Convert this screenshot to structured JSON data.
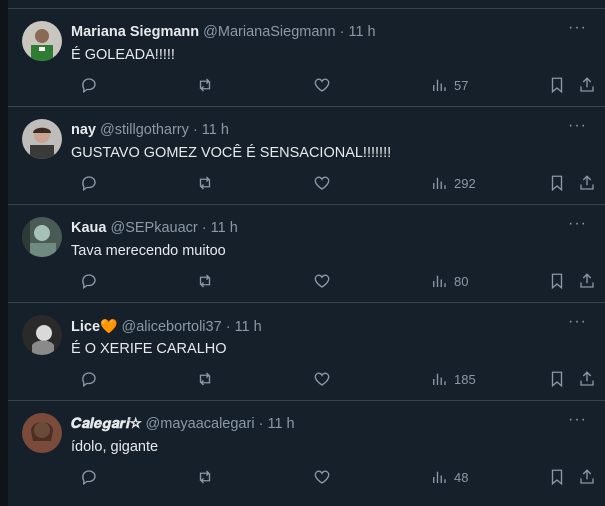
{
  "tweets": [
    {
      "name": "Mariana Siegmann",
      "handle": "@MarianaSiegmann",
      "time": "11 h",
      "text": "É GOLEADA!!!!!",
      "views": "57",
      "avatar_colors": [
        "#c9c6bf",
        "#2e7d32"
      ]
    },
    {
      "name": "nay",
      "handle": "@stillgotharry",
      "time": "11 h",
      "text": "GUSTAVO GOMEZ VOCÊ É SENSACIONAL!!!!!!!",
      "views": "292",
      "avatar_colors": [
        "#bfbcbc",
        "#3a3a3a"
      ]
    },
    {
      "name": "Kaua",
      "handle": "@SEPkauacr",
      "time": "11 h",
      "text": "Tava merecendo muitoo",
      "views": "80",
      "avatar_colors": [
        "#4a5b55",
        "#a7c1b8"
      ]
    },
    {
      "name": "Lice",
      "name_emoji": "🧡",
      "handle": "@alicebortoli37",
      "time": "11 h",
      "text": "É O XERIFE CARALHO",
      "views": "185",
      "avatar_colors": [
        "#2a2a2a",
        "#d9d9d9"
      ]
    },
    {
      "name": "𝑪𝒂𝒍𝒆𝒈𝒂𝒓𝒊☆",
      "handle": "@mayaacalegari",
      "time": "11 h",
      "text": "ídolo, gigante",
      "views": "48",
      "avatar_colors": [
        "#7a4a3a",
        "#d6a98b"
      ]
    }
  ],
  "ui": {
    "separator": "·",
    "more": "···"
  },
  "colors": {
    "background": "#15202b",
    "border": "#38444d",
    "muted": "#8b98a5",
    "text": "#e7e9ea",
    "emoji_heart": "#f4900c"
  }
}
